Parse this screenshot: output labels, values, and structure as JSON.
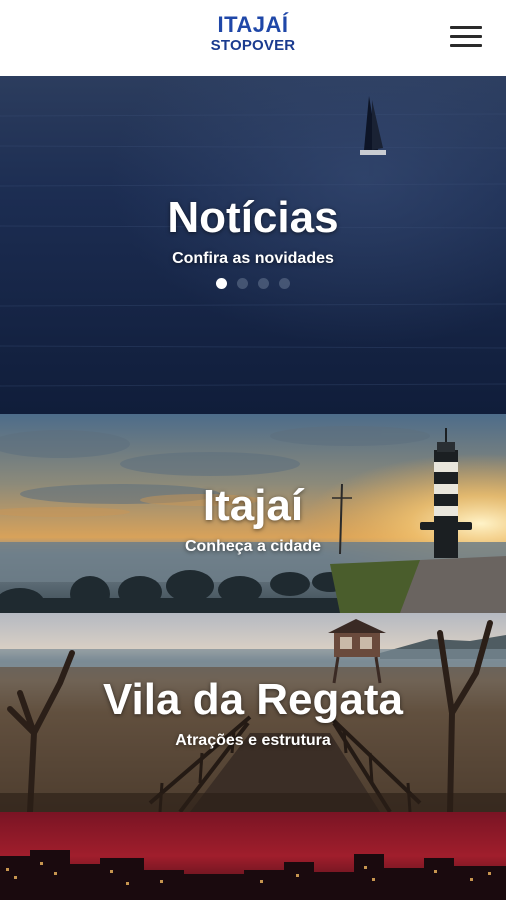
{
  "header": {
    "logo_line1": "ITAJAÍ",
    "logo_line2": "STOPOVER",
    "menu_icon": "hamburger-menu-icon"
  },
  "sections": [
    {
      "title": "Notícias",
      "subtitle": "Confira as novidades",
      "carousel": {
        "slides": 4,
        "active": 1
      }
    },
    {
      "title": "Itajaí",
      "subtitle": "Conheça a cidade"
    },
    {
      "title": "Vila da Regata",
      "subtitle": "Atrações e estrutura"
    },
    {
      "title": "",
      "subtitle": ""
    }
  ],
  "colors": {
    "brand_blue": "#1f47a8",
    "header_bg": "#ffffff",
    "ocean": "#1b2c4f",
    "sunset": "#e8a64a",
    "night_red": "#8a1a2a"
  }
}
